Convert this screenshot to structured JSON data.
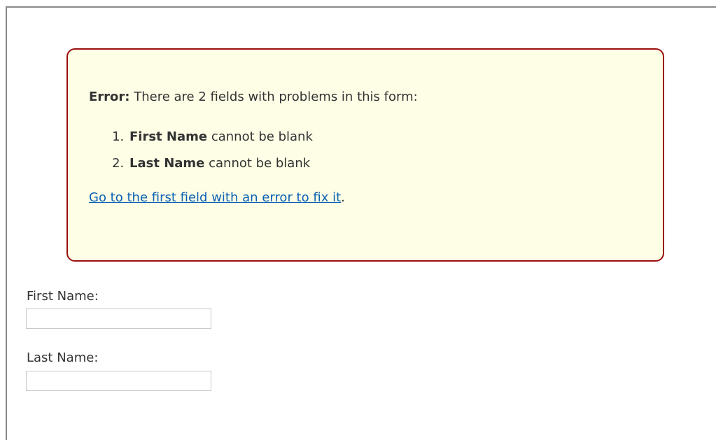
{
  "error": {
    "prefix": "Error:",
    "message": " There are 2 fields with problems in this form:",
    "items": [
      {
        "field": "First Name",
        "problem": " cannot be blank"
      },
      {
        "field": "Last Name",
        "problem": " cannot be blank"
      }
    ],
    "link_text": "Go to the first field with an error to fix it",
    "link_suffix": "."
  },
  "form": {
    "first_name": {
      "label": "First Name:",
      "value": ""
    },
    "last_name": {
      "label": "Last Name:",
      "value": ""
    }
  },
  "colors": {
    "error_border": "#9a0f0f",
    "error_background": "#fefee6",
    "link": "#0b62b3"
  }
}
